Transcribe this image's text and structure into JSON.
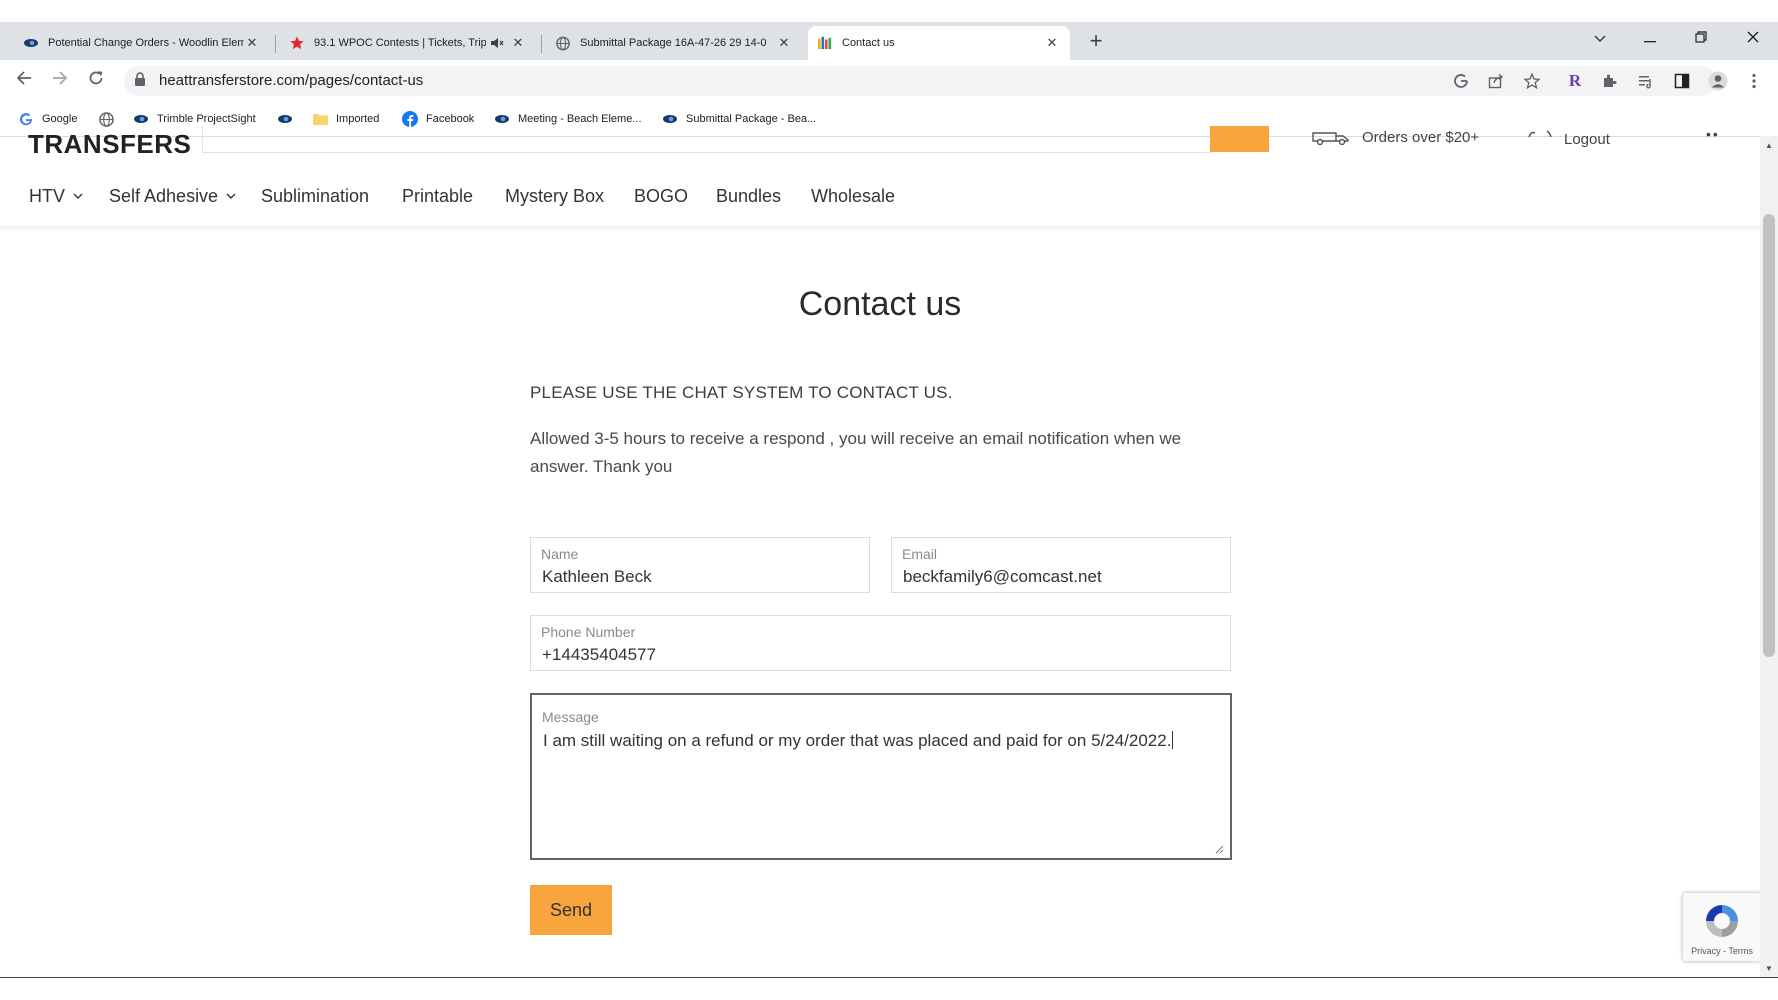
{
  "browser": {
    "tabs": [
      {
        "title": "Potential Change Orders - Woodlin Elem",
        "icon": "trimble-eye-icon"
      },
      {
        "title": "93.1 WPOC Contests | Tickets, Trip",
        "icon": "red-star-icon",
        "muted_icon": "speaker-muted-icon"
      },
      {
        "title": "Submittal Package 16A-47-26 29 14-0",
        "icon": "globe-icon"
      },
      {
        "title": "Contact us",
        "icon": "colorful-bars-icon",
        "active": true
      }
    ],
    "new_tab": "+",
    "address": "heattransferstore.com/pages/contact-us",
    "bookmarks": [
      {
        "label": "Google",
        "icon": "google-icon"
      },
      {
        "label": "",
        "icon": "globe-icon"
      },
      {
        "label": "Trimble ProjectSight",
        "icon": "trimble-eye-icon"
      },
      {
        "label": "",
        "icon": "trimble-eye-icon"
      },
      {
        "label": "Imported",
        "icon": "folder-icon"
      },
      {
        "label": "Facebook",
        "icon": "facebook-icon"
      },
      {
        "label": "Meeting - Beach Eleme...",
        "icon": "trimble-eye-icon"
      },
      {
        "label": "Submittal Package - Bea...",
        "icon": "trimble-eye-icon"
      }
    ],
    "colors": {
      "tabbar": "#dee1e6",
      "omnibox": "#f1f3f4"
    }
  },
  "site": {
    "logo": "TRANSFERS",
    "shipping_text": "Orders over $20+",
    "logout": "Logout",
    "nav": [
      "HTV",
      "Self Adhesive",
      "Sublimination",
      "Printable",
      "Mystery Box",
      "BOGO",
      "Bundles",
      "Wholesale"
    ],
    "accent": "#f7a53c"
  },
  "page": {
    "title": "Contact us",
    "notice": "PLEASE USE THE CHAT SYSTEM TO CONTACT US.",
    "description": "Allowed 3-5 hours to receive a respond , you will receive an email notification when we answer. Thank you"
  },
  "form": {
    "name": {
      "label": "Name",
      "value": "Kathleen Beck"
    },
    "email": {
      "label": "Email",
      "value": "beckfamily6@comcast.net"
    },
    "phone": {
      "label": "Phone Number",
      "value": "+14435404577"
    },
    "message": {
      "label": "Message",
      "value": "I am still waiting on a refund or my order that was placed and paid for on 5/24/2022."
    },
    "send_label": "Send"
  },
  "recaptcha": {
    "text": "Privacy - Terms"
  }
}
